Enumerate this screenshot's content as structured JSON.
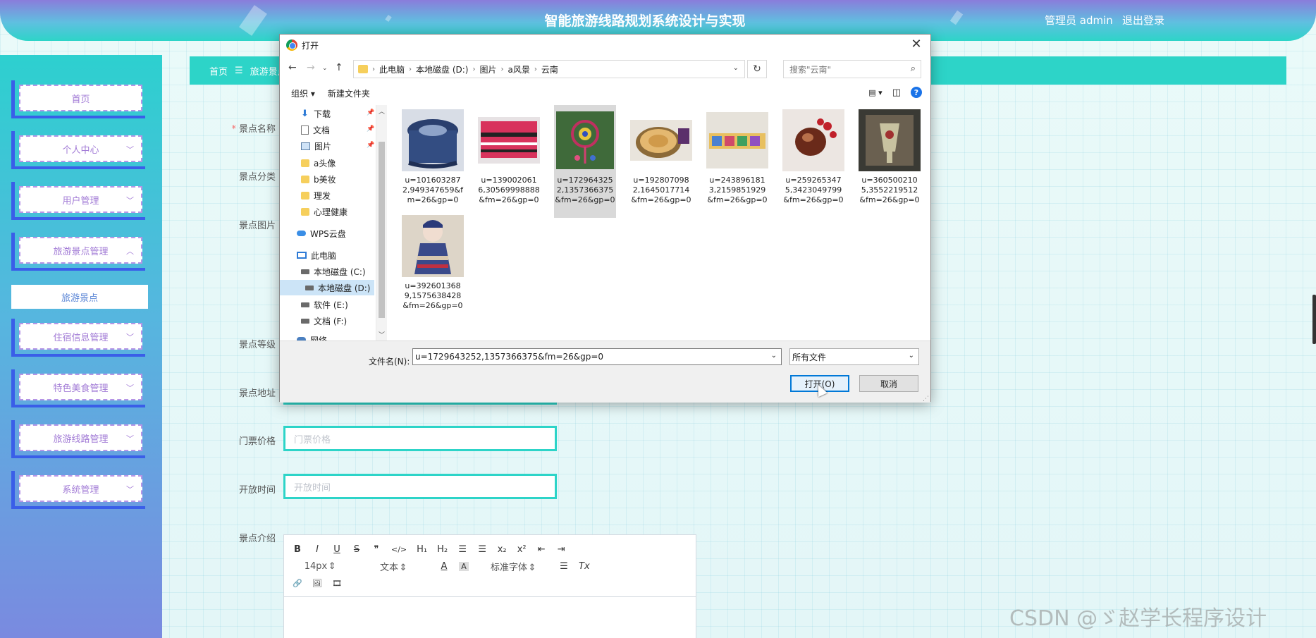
{
  "header": {
    "title": "智能旅游线路规划系统设计与实现",
    "user": "管理员 admin",
    "logout": "退出登录"
  },
  "sidebar": {
    "items": [
      {
        "label": "首页"
      },
      {
        "label": "个人中心"
      },
      {
        "label": "用户管理"
      },
      {
        "label": "旅游景点管理"
      },
      {
        "label": "住宿信息管理"
      },
      {
        "label": "特色美食管理"
      },
      {
        "label": "旅游线路管理"
      },
      {
        "label": "系统管理"
      }
    ],
    "submenu_active": "旅游景点"
  },
  "breadcrumb": {
    "home": "首页",
    "sep": "☰",
    "current": "旅游景点"
  },
  "form": {
    "labels": {
      "name": "景点名称",
      "category": "景点分类",
      "image": "景点图片",
      "level": "景点等级",
      "address": "景点地址",
      "price": "门票价格",
      "open_time": "开放时间",
      "intro": "景点介绍"
    },
    "required_mark": "*",
    "price_placeholder": "门票价格",
    "open_time_placeholder": "开放时间",
    "editor": {
      "row1": [
        "B",
        "I",
        "U",
        "S",
        "❞",
        "</>",
        "H₁",
        "H₂",
        "☰",
        "☰",
        "x₂",
        "x²",
        "⇤",
        "⇥"
      ],
      "font_size": "14px",
      "text_style": "文本",
      "font_color": "A",
      "bg_color": "A",
      "font_family": "标准字体",
      "align": "☰",
      "clear": "Tx",
      "row3": [
        "🔗",
        "🖼",
        "🎞"
      ]
    }
  },
  "watermark": "CSDN @ゞ赵学长程序设计",
  "dialog": {
    "title": "打开",
    "close": "✕",
    "address": {
      "segments": [
        "此电脑",
        "本地磁盘 (D:)",
        "图片",
        "a风景",
        "云南"
      ]
    },
    "search_placeholder": "搜索\"云南\"",
    "commands": {
      "organize": "组织 ▾",
      "new_folder": "新建文件夹",
      "help": "?"
    },
    "nav": [
      {
        "label": "下载",
        "icon": "download-icon",
        "pinned": true
      },
      {
        "label": "文档",
        "icon": "document-icon",
        "pinned": true
      },
      {
        "label": "图片",
        "icon": "picture-icon",
        "pinned": true
      },
      {
        "label": "a头像",
        "icon": "folder-icon"
      },
      {
        "label": "b美妆",
        "icon": "folder-icon"
      },
      {
        "label": "理发",
        "icon": "folder-icon"
      },
      {
        "label": "心理健康",
        "icon": "folder-icon"
      },
      {
        "label": "WPS云盘",
        "icon": "cloud-icon"
      },
      {
        "label": "此电脑",
        "icon": "computer-icon"
      },
      {
        "label": "本地磁盘 (C:)",
        "icon": "drive-icon"
      },
      {
        "label": "本地磁盘 (D:)",
        "icon": "drive-icon",
        "selected": true
      },
      {
        "label": "软件 (E:)",
        "icon": "drive-icon"
      },
      {
        "label": "文档 (F:)",
        "icon": "drive-icon"
      },
      {
        "label": "网络",
        "icon": "network-icon"
      }
    ],
    "files": [
      {
        "name": "u=1016032872,949347659&fm=26&gp=0"
      },
      {
        "name": "u=1390020616,30569998888&fm=26&gp=0"
      },
      {
        "name": "u=1729643252,1357366375&fm=26&gp=0",
        "selected": true
      },
      {
        "name": "u=1928070982,1645017714&fm=26&gp=0"
      },
      {
        "name": "u=2438961813,2159851929&fm=26&gp=0"
      },
      {
        "name": "u=2592653475,3423049799&fm=26&gp=0"
      },
      {
        "name": "u=3605002105,3552219512&fm=26&gp=0"
      },
      {
        "name": "u=3926013689,1575638428&fm=26&gp=0"
      }
    ],
    "filename_label": "文件名(N):",
    "filename_value": "u=1729643252,1357366375&fm=26&gp=0",
    "filetype": "所有文件",
    "open_button": "打开(O)",
    "cancel_button": "取消"
  }
}
